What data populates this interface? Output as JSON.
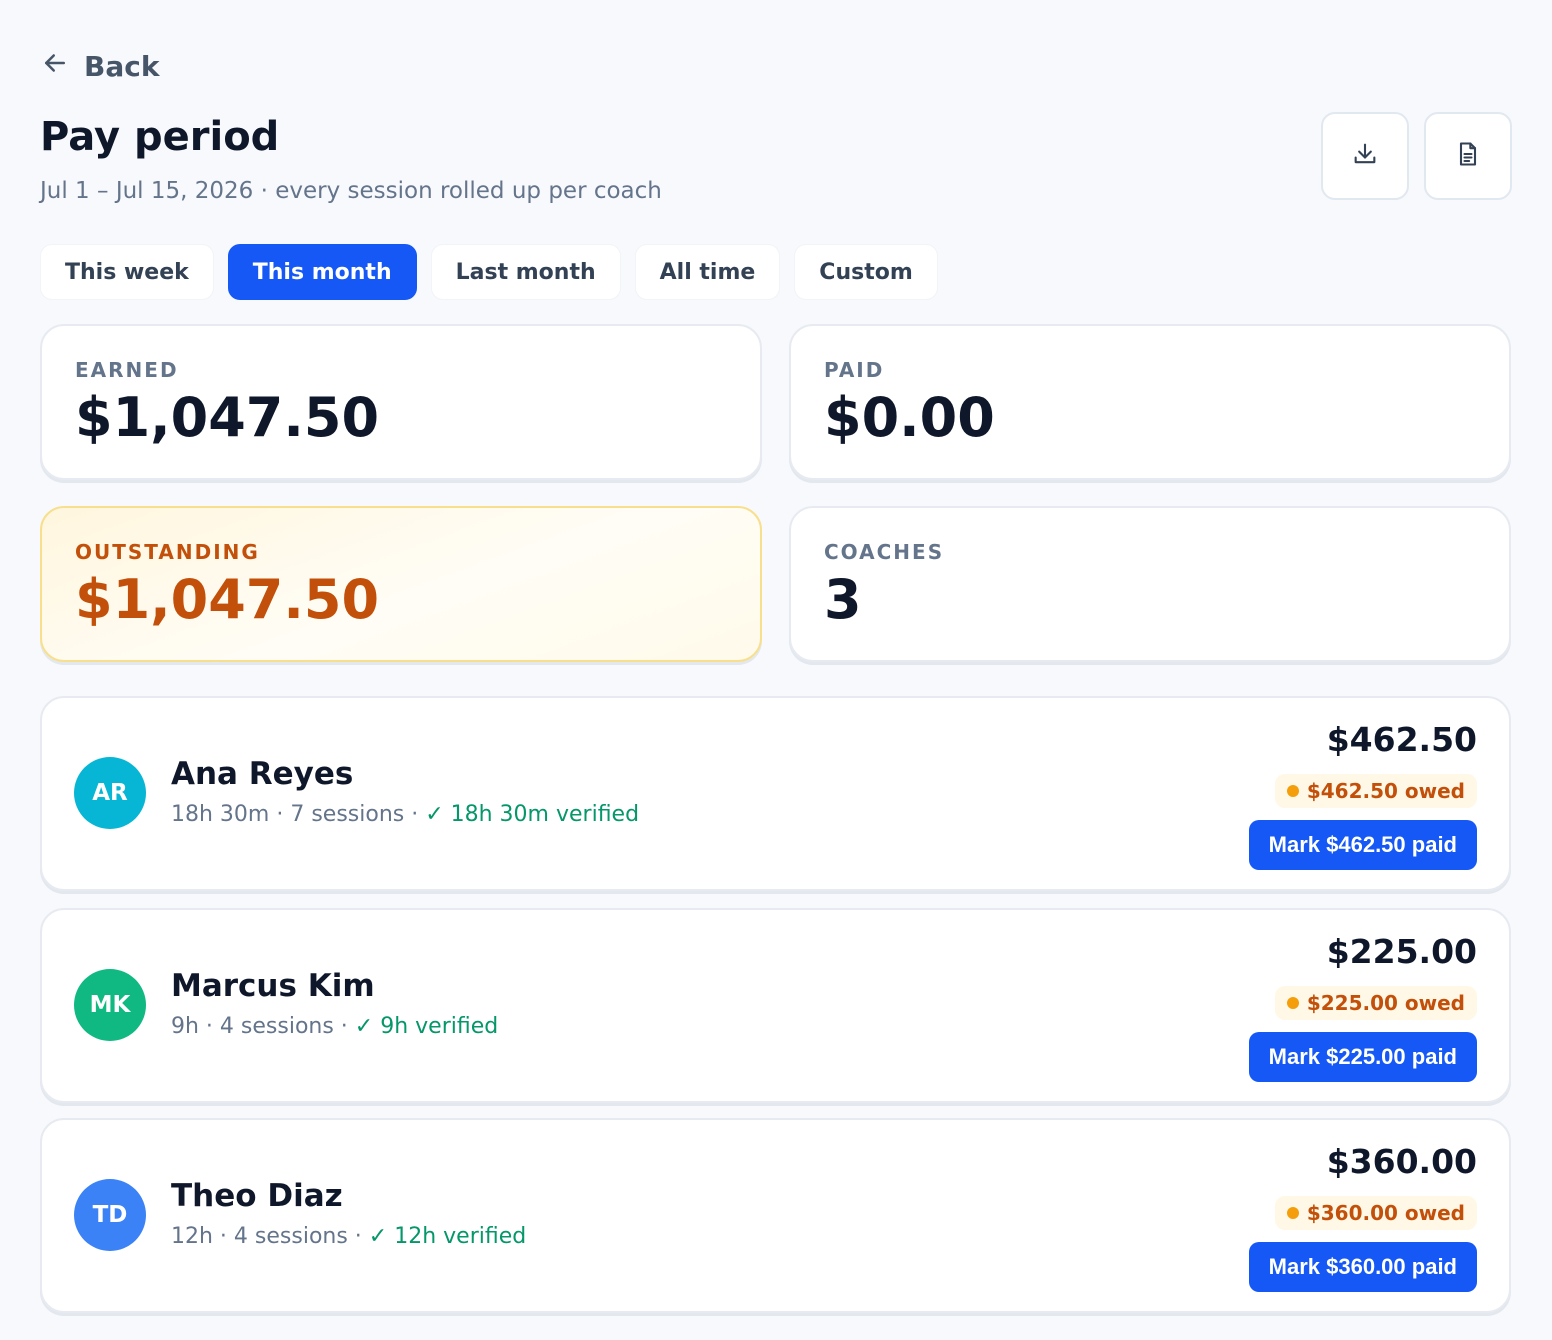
{
  "nav": {
    "back_label": "Back"
  },
  "header": {
    "title": "Pay period",
    "subtitle": "Jul 1 – Jul 15, 2026 · every session rolled up per coach",
    "actions": [
      "download-icon",
      "document-icon"
    ]
  },
  "tabs": [
    {
      "label": "This week",
      "active": false
    },
    {
      "label": "This month",
      "active": true
    },
    {
      "label": "Last month",
      "active": false
    },
    {
      "label": "All time",
      "active": false
    },
    {
      "label": "Custom",
      "active": false
    }
  ],
  "stats": {
    "earned": {
      "label": "EARNED",
      "value": "$1,047.50"
    },
    "paid": {
      "label": "PAID",
      "value": "$0.00"
    },
    "outstanding": {
      "label": "OUTSTANDING",
      "value": "$1,047.50"
    },
    "coaches": {
      "label": "COACHES",
      "value": "3"
    }
  },
  "coaches": [
    {
      "initials": "AR",
      "avatar_color": "#06b6d4",
      "name": "Ana Reyes",
      "meta": "18h 30m · 7 sessions · ",
      "verified": "✓ 18h 30m verified",
      "amount": "$462.50",
      "owed": "$462.50 owed",
      "button": "Mark $462.50 paid"
    },
    {
      "initials": "MK",
      "avatar_color": "#10b981",
      "name": "Marcus Kim",
      "meta": "9h · 4 sessions · ",
      "verified": "✓ 9h verified",
      "amount": "$225.00",
      "owed": "$225.00 owed",
      "button": "Mark $225.00 paid"
    },
    {
      "initials": "TD",
      "avatar_color": "#3b82f6",
      "name": "Theo Diaz",
      "meta": "12h · 4 sessions · ",
      "verified": "✓ 12h verified",
      "amount": "$360.00",
      "owed": "$360.00 owed",
      "button": "Mark $360.00 paid"
    }
  ],
  "colors": {
    "accent": "#1558f5",
    "warning": "#c2500a",
    "success": "#059669"
  }
}
